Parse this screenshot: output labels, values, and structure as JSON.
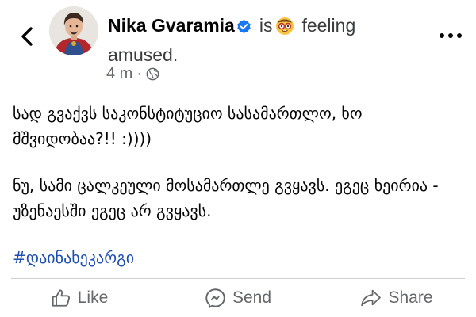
{
  "post": {
    "author": "Nika Gvaramia",
    "is_text": "is",
    "feeling_text": "feeling",
    "feeling_value": "amused.",
    "timestamp": "4 m",
    "separator": "·",
    "audience_icon": "globe-icon",
    "paragraphs": [
      "სად გვაქვს საკონსტიტუციო სასამართლო, ხო მშვიდობაა?!! :))))",
      "ნუ, სამი ცალკეული მოსამართლე გვყავს. ეგეც ხეირია - უზენაესში ეგეც არ გვყავს."
    ],
    "hashtag": "#დაინახეკარგი"
  },
  "actions": {
    "like_label": "Like",
    "send_label": "Send",
    "share_label": "Share"
  },
  "colors": {
    "verified": "#1877f2",
    "hashtag": "#1b4db3",
    "secondary_text": "#65676b",
    "divider": "#ced0d4"
  }
}
